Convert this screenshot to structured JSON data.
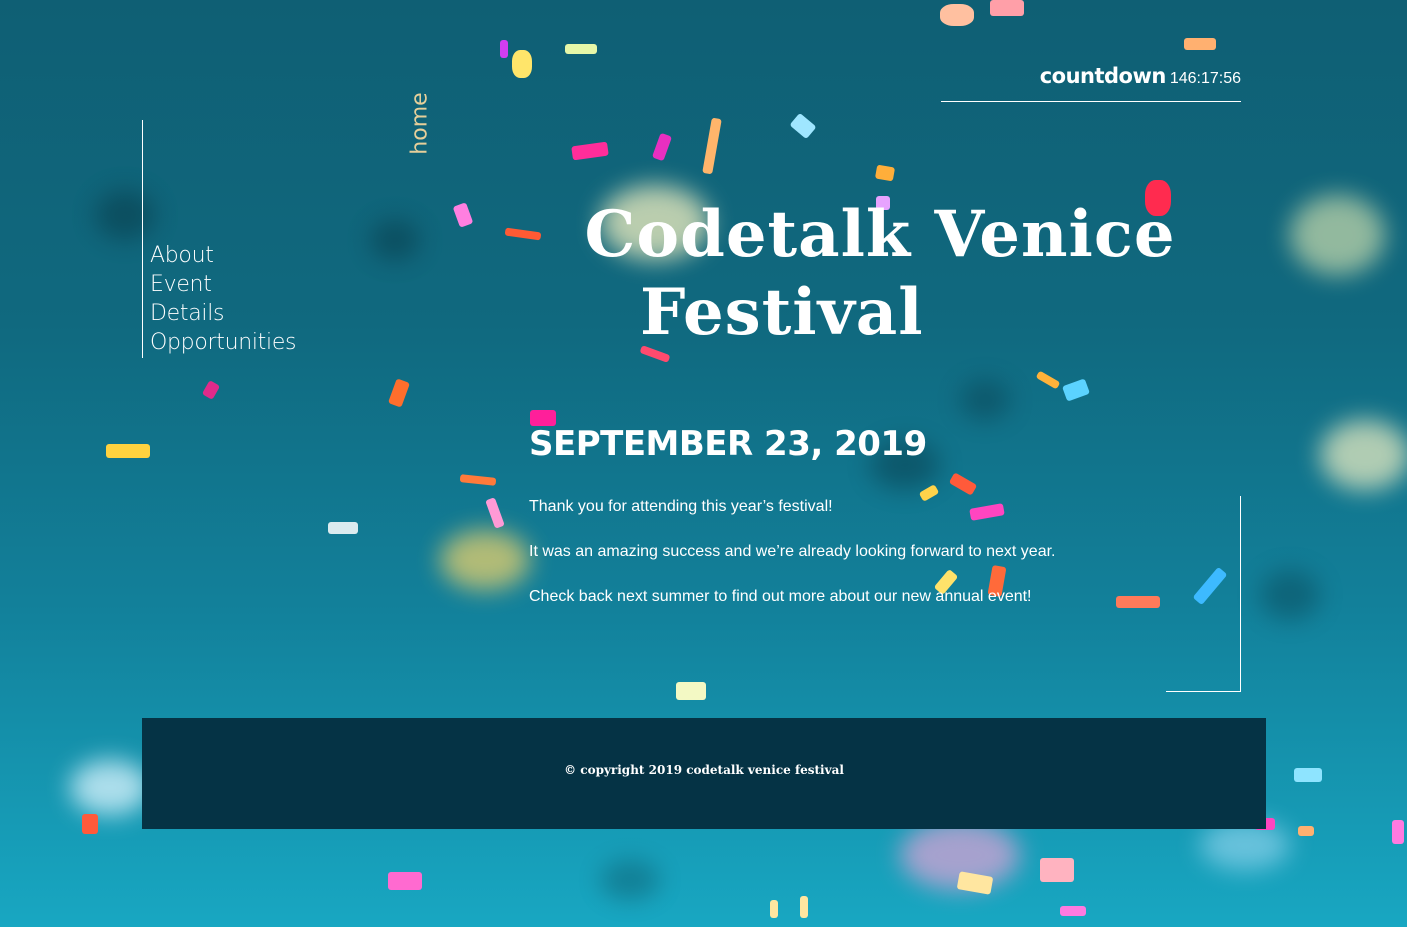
{
  "countdown": {
    "label": "countdown",
    "value": "146:17:56"
  },
  "nav": {
    "home": "home",
    "items": [
      {
        "label": "About"
      },
      {
        "label": "Event"
      },
      {
        "label": "Details"
      },
      {
        "label": "Opportunities"
      }
    ]
  },
  "hero": {
    "title_line1": "Codetalk Venice",
    "title_line2": "Festival",
    "date": "SEPTEMBER 23, 2019",
    "messages": [
      "Thank you for attending this year’s festival!",
      "It was an amazing success and we’re already looking forward to next year.",
      "Check back next summer to find out more about our new annual event!"
    ]
  },
  "footer": {
    "copyright": "© copyright 2019 codetalk venice festival"
  },
  "colors": {
    "accent_home": "#e6cf9a",
    "footer_bg": "#053345",
    "text": "#ffffff"
  }
}
